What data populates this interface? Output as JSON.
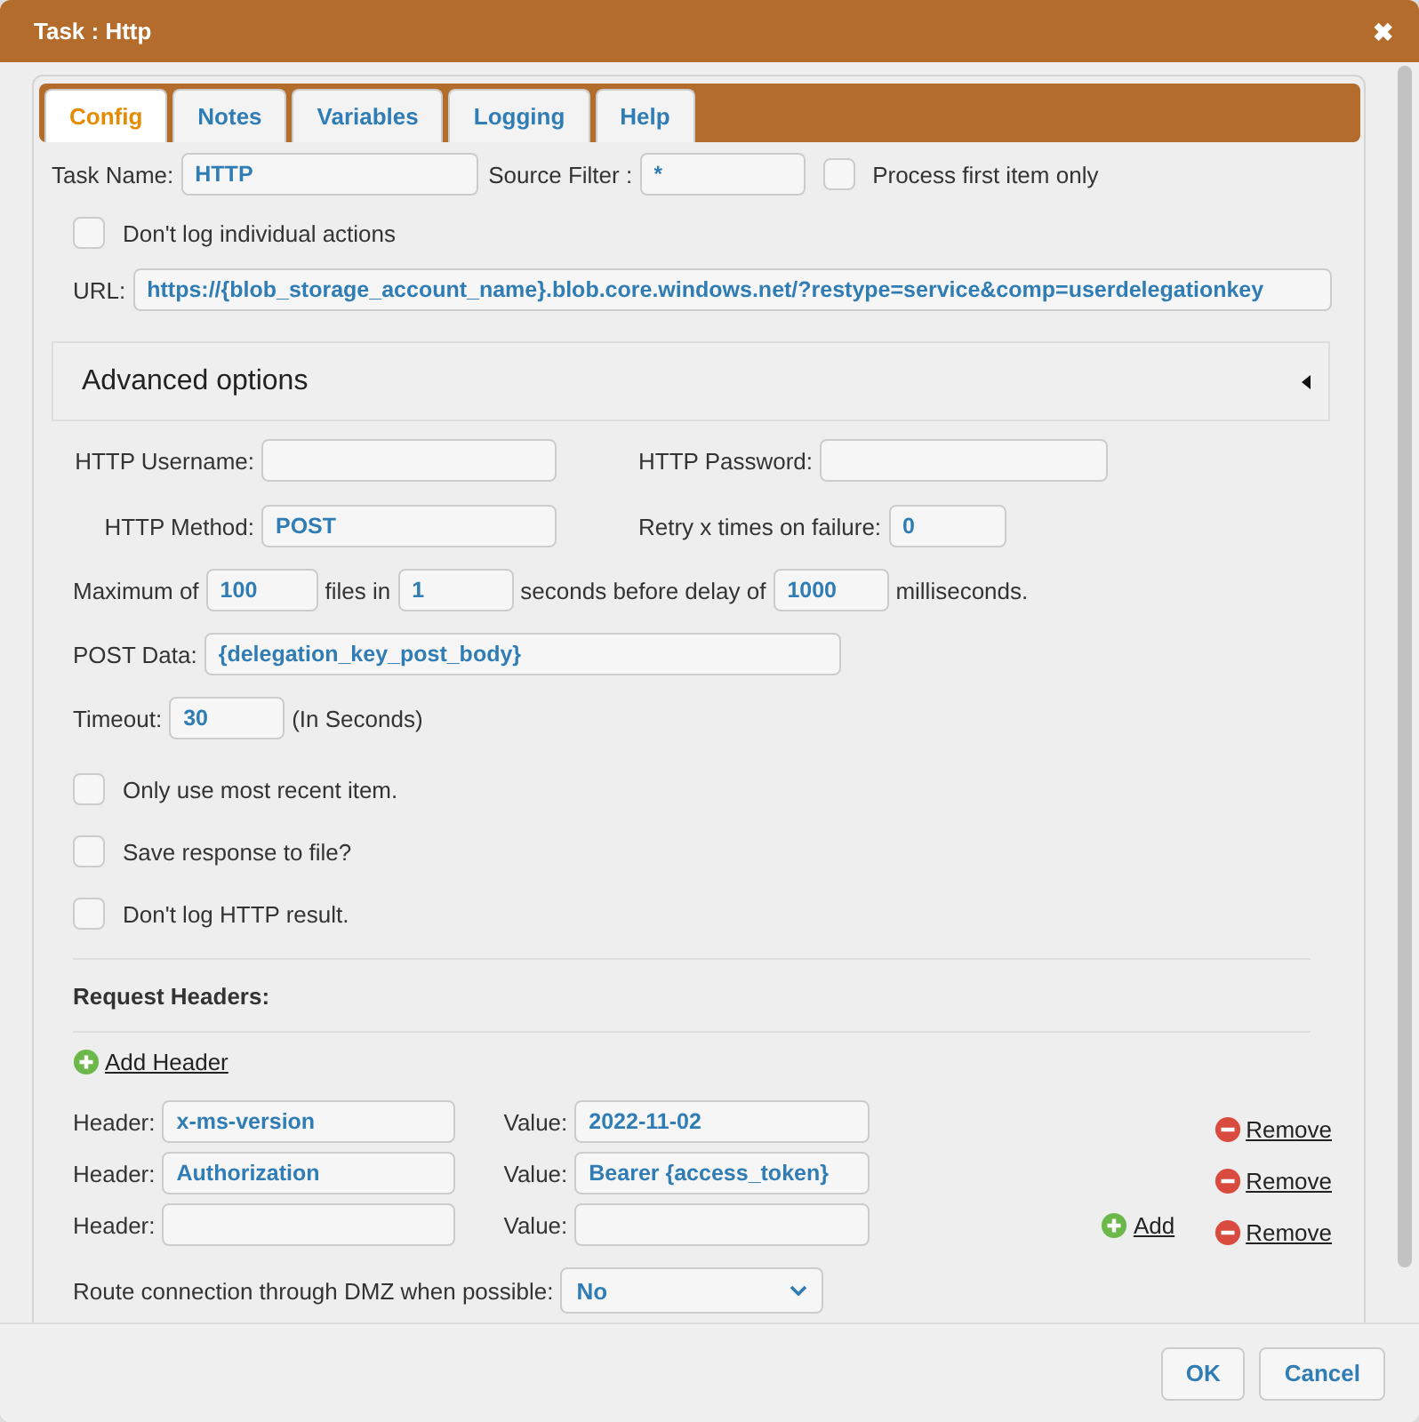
{
  "window": {
    "title": "Task : Http",
    "close_glyph": "✖"
  },
  "tabs": [
    {
      "label": "Config",
      "selected": true
    },
    {
      "label": "Notes",
      "selected": false
    },
    {
      "label": "Variables",
      "selected": false
    },
    {
      "label": "Logging",
      "selected": false
    },
    {
      "label": "Help",
      "selected": false
    }
  ],
  "task_name": {
    "label": "Task Name:",
    "value": "HTTP"
  },
  "source_filter": {
    "label": "Source Filter :",
    "value": "*"
  },
  "process_first": {
    "label": "Process first item only",
    "checked": false
  },
  "dont_log_actions": {
    "label": "Don't log individual actions",
    "checked": false
  },
  "url": {
    "label": "URL:",
    "value": "https://{blob_storage_account_name}.blob.core.windows.net/?restype=service&comp=userdelegationkey"
  },
  "advanced": {
    "title": "Advanced options"
  },
  "username": {
    "label": "HTTP Username:"
  },
  "password": {
    "label": "HTTP Password:"
  },
  "method": {
    "label": "HTTP Method:",
    "value": "POST"
  },
  "retry": {
    "label": "Retry x times on failure:",
    "value": "0"
  },
  "rate": [
    {
      "kind": "text",
      "text": "Maximum of"
    },
    {
      "kind": "field",
      "value": "100"
    },
    {
      "kind": "text",
      "text": "files in"
    },
    {
      "kind": "field",
      "value": "1"
    },
    {
      "kind": "text",
      "text": "seconds before delay of"
    },
    {
      "kind": "field",
      "value": "1000"
    },
    {
      "kind": "text",
      "text": "milliseconds."
    }
  ],
  "post_data": {
    "label": "POST Data:",
    "value": "{delegation_key_post_body}"
  },
  "timeout": {
    "label": "Timeout:",
    "value": "30",
    "suffix": "(In Seconds)"
  },
  "options": [
    {
      "label": "Only use most recent item.",
      "checked": false
    },
    {
      "label": "Save response to file?",
      "checked": false
    },
    {
      "label": "Don't log HTTP result.",
      "checked": false
    }
  ],
  "request_headers": {
    "title": "Request Headers:",
    "add_header": "Add Header",
    "rows": [
      {
        "header_label": "Header:",
        "header": "x-ms-version",
        "value_label": "Value:",
        "value": "2022-11-02",
        "remove": "Remove"
      },
      {
        "header_label": "Header:",
        "header": "Authorization",
        "value_label": "Value:",
        "value": "Bearer {access_token}",
        "remove": "Remove"
      },
      {
        "header_label": "Header:",
        "value_label": "Value:",
        "add": "Add",
        "remove": "Remove"
      }
    ]
  },
  "dmz": {
    "label": "Route connection through DMZ when possible:",
    "value": "No"
  },
  "buttons": [
    "OK",
    "Cancel"
  ]
}
